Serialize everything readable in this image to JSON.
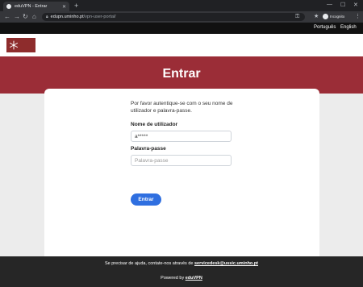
{
  "browser": {
    "tab_title": "eduVPN - Entrar",
    "url_host": "edupn.uminho.pt",
    "url_path": "/vpn-user-portal/",
    "incognito_label": "Incognito"
  },
  "lang_bar": {
    "portuguese": "Português",
    "english": "English"
  },
  "page": {
    "title": "Entrar",
    "intro": "Por favor autentique-se com o seu nome de utilizador e palavra-passe.",
    "username_label": "Nome de utilizador",
    "username_value": "a*****",
    "password_label": "Palavra-passe",
    "password_placeholder": "Palavra-passe",
    "submit_label": "Entrar"
  },
  "footer": {
    "help_prefix": "Se precisar de ajuda, contate-nos através de",
    "help_email": "servicedesk@ussic.uminho.pt",
    "powered_prefix": "Powered by",
    "powered_link": "eduVPN"
  },
  "colors": {
    "brand": "#9b2d37",
    "button": "#2f6fe0",
    "footer": "#262626"
  }
}
